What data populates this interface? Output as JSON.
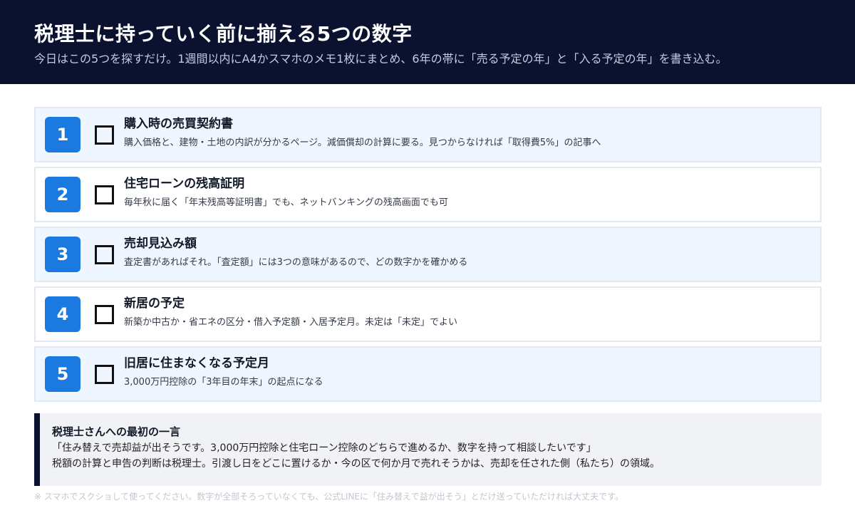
{
  "header": {
    "title": "税理士に持っていく前に揃える5つの数字",
    "subtitle": "今日はこの5つを探すだけ。1週間以内にA4かスマホのメモ1枚にまとめ、6年の帯に「売る予定の年」と「入る予定の年」を書き込む。"
  },
  "items": [
    {
      "number": "1",
      "title": "購入時の売買契約書",
      "desc": "購入価格と、建物・土地の内訳が分かるページ。減価償却の計算に要る。見つからなければ「取得費5%」の記事へ"
    },
    {
      "number": "2",
      "title": "住宅ローンの残高証明",
      "desc": "毎年秋に届く「年末残高等証明書」でも、ネットバンキングの残高画面でも可"
    },
    {
      "number": "3",
      "title": "売却見込み額",
      "desc": "査定書があればそれ。「査定額」には3つの意味があるので、どの数字かを確かめる"
    },
    {
      "number": "4",
      "title": "新居の予定",
      "desc": "新築か中古か・省エネの区分・借入予定額・入居予定月。未定は「未定」でよい"
    },
    {
      "number": "5",
      "title": "旧居に住まなくなる予定月",
      "desc": "3,000万円控除の「3年目の年末」の起点になる"
    }
  ],
  "note": {
    "title": "税理士さんへの最初の一言",
    "line1": "「住み替えで売却益が出そうです。3,000万円控除と住宅ローン控除のどちらで進めるか、数字を持って相談したいです」",
    "line2": "税額の計算と申告の判断は税理士。引渡し日をどこに置けるか・今の区で何か月で売れそうかは、売却を任された側（私たち）の領域。"
  },
  "footer": {
    "text": "※ スマホでスクショして使ってください。数字が全部そろっていなくても、公式LINEに「住み替えで益が出そう」とだけ送っていただければ大丈夫です。"
  },
  "colors": {
    "header_bg": "#0a1230",
    "accent": "#1a7ae0",
    "row_alt_bg": "#eff6ff",
    "note_bg": "#f0f2f5"
  }
}
